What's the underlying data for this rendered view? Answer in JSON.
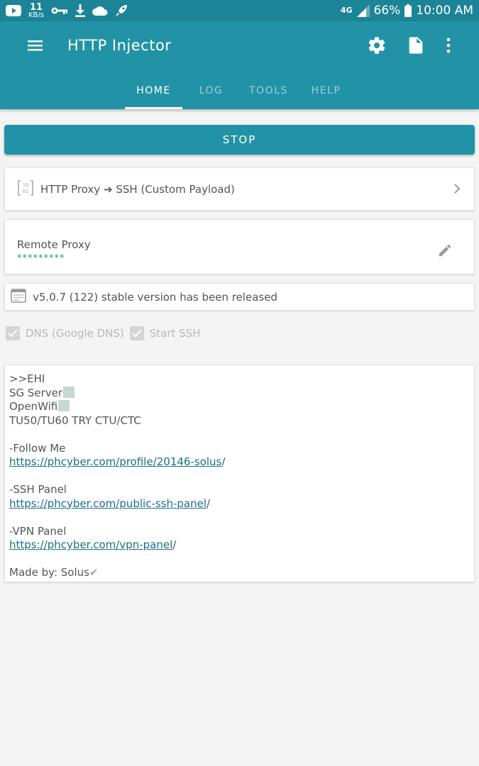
{
  "status_bar": {
    "net_speed_value": "11",
    "net_speed_unit": "KB/s",
    "network_type": "4G",
    "battery": "66%",
    "time": "10:00 AM"
  },
  "app_bar": {
    "title": "HTTP Injector",
    "tabs": [
      {
        "label": "HOME",
        "active": true
      },
      {
        "label": "LOG",
        "active": false
      },
      {
        "label": "TOOLS",
        "active": false
      },
      {
        "label": "HELP",
        "active": false
      }
    ]
  },
  "main": {
    "stop_label": "STOP",
    "mode_label": "HTTP Proxy ➔ SSH (Custom Payload)",
    "remote_proxy_title": "Remote Proxy",
    "remote_proxy_value": "*********",
    "news_label": "v5.0.7 (122) stable version has been released",
    "checkbox_dns": "DNS (Google DNS)",
    "checkbox_ssh": "Start SSH",
    "message": {
      "line1": ">>EHI",
      "line2": "SG Server",
      "line3": "OpenWifi",
      "line4": "TU50/TU60 TRY CTU/CTC",
      "line5": "-Follow Me",
      "link1": "https://phcyber.com/profile/20146-solus",
      "link1_suffix": "/",
      "line6": "-SSH Panel",
      "link2": "https://phcyber.com/public-ssh-panel",
      "link2_suffix": "/",
      "line7": "-VPN Panel",
      "link3": "https://phcyber.com/vpn-panel",
      "link3_suffix": "/",
      "line8": "Made by: Solus",
      "checkmark": "✔"
    }
  },
  "colors": {
    "primary": "#2293a6",
    "status_bar": "#1b8497",
    "link": "#1b6f86"
  },
  "icons": {
    "status_bar": [
      "youtube-icon",
      "key-icon",
      "download-icon",
      "cloud-icon",
      "rocket-icon",
      "signal-icon"
    ],
    "toolbar": [
      "menu-icon",
      "settings-icon",
      "file-icon",
      "more-vert-icon"
    ]
  }
}
